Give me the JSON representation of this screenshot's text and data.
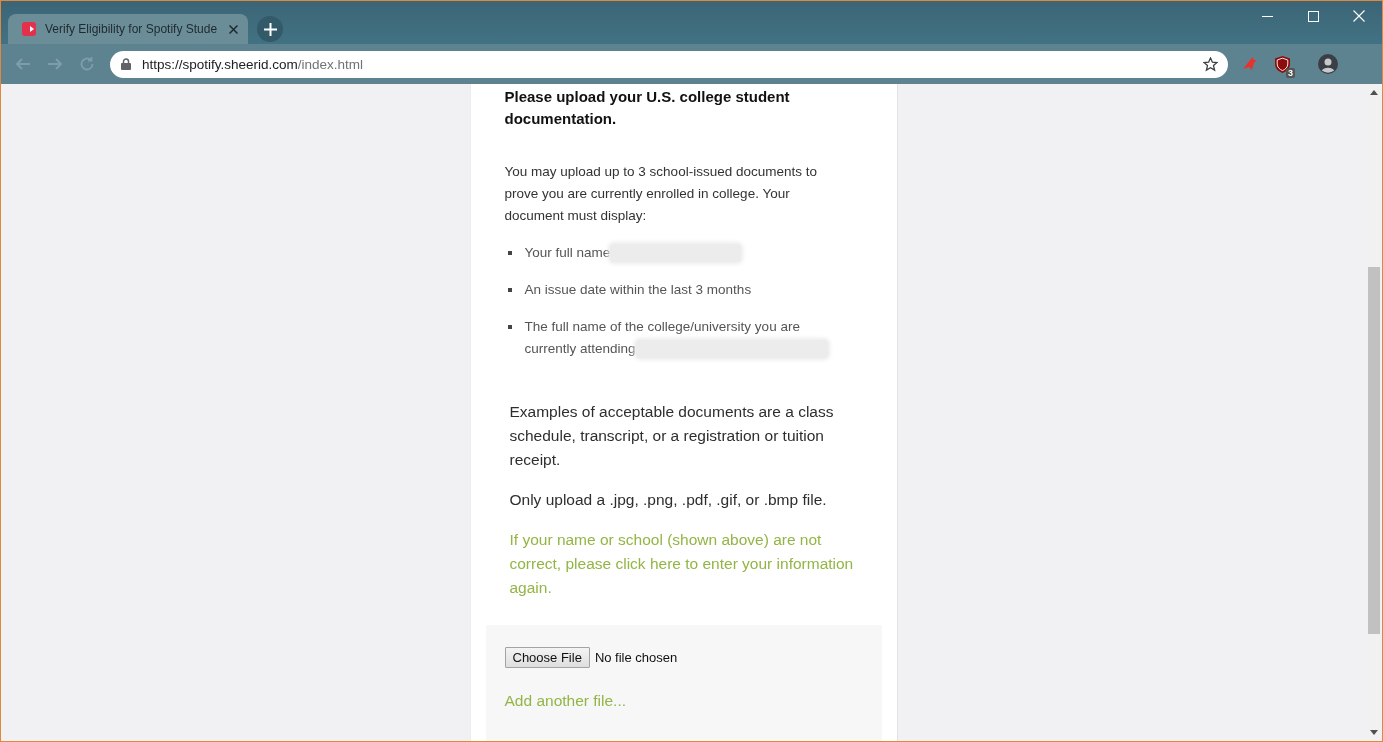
{
  "browser": {
    "tabs": [
      {
        "title": "Verify Eligibility for Spotify Stude",
        "selected": true
      }
    ],
    "address_bar": {
      "host": "https://spotify.sheerid.com",
      "path": "/index.html"
    },
    "extension_badge": "3"
  },
  "page": {
    "heading": "Please upload your U.S. college student documentation.",
    "intro": "You may upload up to 3 school-issued documents to prove you are currently enrolled in college. Your document must display:",
    "requirements": [
      {
        "text": "Your full name",
        "redacted": true
      },
      {
        "text": "An issue date within the last 3 months",
        "redacted": false
      },
      {
        "text": "The full name of the college/university you are currently attending",
        "redacted": true
      }
    ],
    "examples": "Examples of acceptable documents are a class schedule, transcript, or a registration or tuition receipt.",
    "file_types": "Only upload a .jpg, .png, .pdf, .gif, or .bmp file.",
    "correction_link": "If your name or school (shown above) are not correct, please click here to enter your information again.",
    "upload": {
      "button": "Choose File",
      "status": "No file chosen",
      "add_link": "Add another file..."
    }
  }
}
